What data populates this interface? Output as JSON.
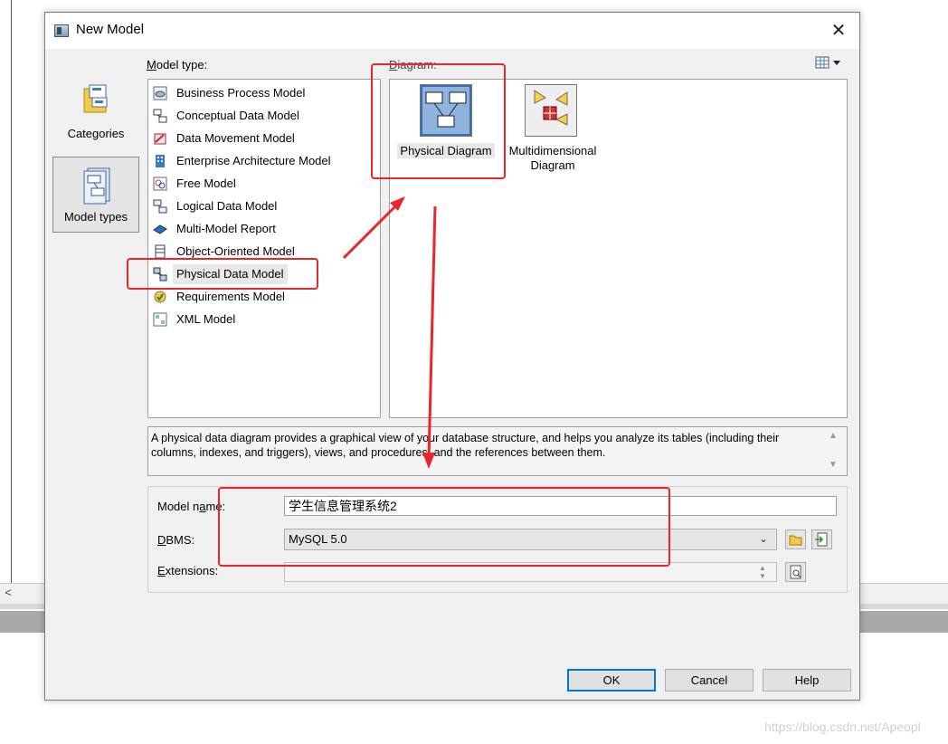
{
  "dialog": {
    "title": "New Model",
    "close_glyph": "✕"
  },
  "categories": [
    {
      "label": "Categories",
      "selected": false
    },
    {
      "label": "Model types",
      "selected": true
    }
  ],
  "model_type": {
    "label_accel": "M",
    "label_rest": "odel type:",
    "items": [
      {
        "label": "Business Process Model",
        "icon": "business-process-icon"
      },
      {
        "label": "Conceptual Data Model",
        "icon": "conceptual-data-icon"
      },
      {
        "label": "Data Movement Model",
        "icon": "data-movement-icon"
      },
      {
        "label": "Enterprise Architecture Model",
        "icon": "enterprise-architecture-icon"
      },
      {
        "label": "Free Model",
        "icon": "free-model-icon"
      },
      {
        "label": "Logical Data Model",
        "icon": "logical-data-icon"
      },
      {
        "label": "Multi-Model Report",
        "icon": "multi-model-report-icon"
      },
      {
        "label": "Object-Oriented Model",
        "icon": "object-oriented-icon"
      },
      {
        "label": "Physical Data Model",
        "icon": "physical-data-icon",
        "selected": true
      },
      {
        "label": "Requirements Model",
        "icon": "requirements-icon"
      },
      {
        "label": "XML Model",
        "icon": "xml-model-icon"
      }
    ]
  },
  "diagram": {
    "label_accel": "D",
    "label_rest": "iagram:",
    "items": [
      {
        "label": "Physical Diagram",
        "selected": true
      },
      {
        "label": "Multidimensional Diagram",
        "selected": false
      }
    ]
  },
  "description": "A physical data diagram provides a graphical view of your database structure, and helps you analyze its tables (including their columns, indexes, and triggers), views, and procedures, and the references between them.",
  "properties": {
    "model_name": {
      "label_pre": "Model n",
      "label_accel": "a",
      "label_post": "me:",
      "value": "学生信息管理系统2"
    },
    "dbms": {
      "label_accel": "D",
      "label_rest": "BMS:",
      "value": "MySQL 5.0"
    },
    "extensions": {
      "label_accel": "E",
      "label_rest": "xtensions:",
      "value": ""
    }
  },
  "buttons": {
    "ok": "OK",
    "cancel": "Cancel",
    "help": "Help"
  },
  "watermark": "https://blog.csdn.net/Apeopl",
  "colors": {
    "annotation_red": "#e8262b",
    "focus_blue": "#0078d7"
  }
}
